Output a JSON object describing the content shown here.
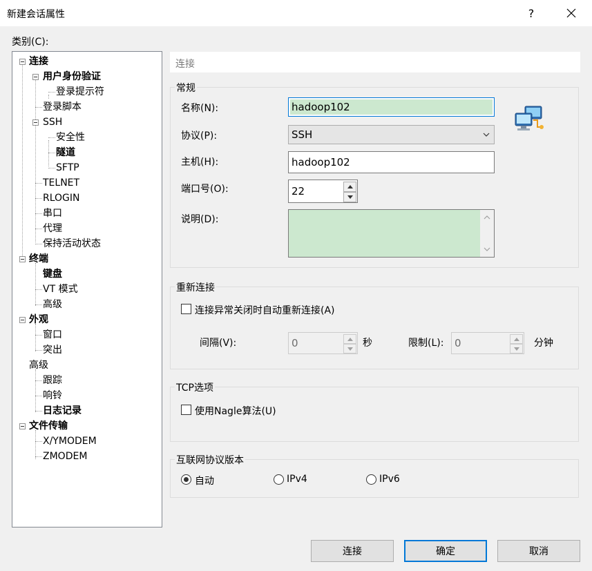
{
  "window": {
    "title": "新建会话属性",
    "help": "?",
    "close_icon": "close-icon"
  },
  "category_label": "类别(C):",
  "tree": [
    {
      "label": "连接",
      "bold": true
    },
    {
      "label": "用户身份验证",
      "bold": true
    },
    {
      "label": "登录提示符",
      "bold": false
    },
    {
      "label": "登录脚本",
      "bold": false
    },
    {
      "label": "SSH",
      "bold": false
    },
    {
      "label": "安全性",
      "bold": false
    },
    {
      "label": "隧道",
      "bold": true
    },
    {
      "label": "SFTP",
      "bold": false
    },
    {
      "label": "TELNET",
      "bold": false
    },
    {
      "label": "RLOGIN",
      "bold": false
    },
    {
      "label": "串口",
      "bold": false
    },
    {
      "label": "代理",
      "bold": false
    },
    {
      "label": "保持活动状态",
      "bold": false
    },
    {
      "label": "终端",
      "bold": true
    },
    {
      "label": "键盘",
      "bold": true
    },
    {
      "label": "VT 模式",
      "bold": false
    },
    {
      "label": "高级",
      "bold": false
    },
    {
      "label": "外观",
      "bold": true
    },
    {
      "label": "窗口",
      "bold": false
    },
    {
      "label": "突出",
      "bold": false
    },
    {
      "label": "高级",
      "bold": false
    },
    {
      "label": "跟踪",
      "bold": false
    },
    {
      "label": "响铃",
      "bold": false
    },
    {
      "label": "日志记录",
      "bold": true
    },
    {
      "label": "文件传输",
      "bold": true
    },
    {
      "label": "X/YMODEM",
      "bold": false
    },
    {
      "label": "ZMODEM",
      "bold": false
    }
  ],
  "panel": {
    "header": "连接",
    "general": {
      "title": "常规",
      "name_label": "名称(N):",
      "name_value": "hadoop102",
      "protocol_label": "协议(P):",
      "protocol_value": "SSH",
      "host_label": "主机(H):",
      "host_value": "hadoop102",
      "port_label": "端口号(O):",
      "port_value": "22",
      "desc_label": "说明(D):",
      "desc_value": ""
    },
    "reconnect": {
      "title": "重新连接",
      "checkbox_label": "连接异常关闭时自动重新连接(A)",
      "interval_label": "间隔(V):",
      "interval_value": "0",
      "interval_unit": "秒",
      "limit_label": "限制(L):",
      "limit_value": "0",
      "limit_unit": "分钟"
    },
    "tcp": {
      "title": "TCP选项",
      "nagle_label": "使用Nagle算法(U)"
    },
    "ip": {
      "title": "互联网协议版本",
      "options": [
        "自动",
        "IPv4",
        "IPv6"
      ],
      "selected": "自动"
    }
  },
  "buttons": {
    "connect": "连接",
    "ok": "确定",
    "cancel": "取消"
  }
}
